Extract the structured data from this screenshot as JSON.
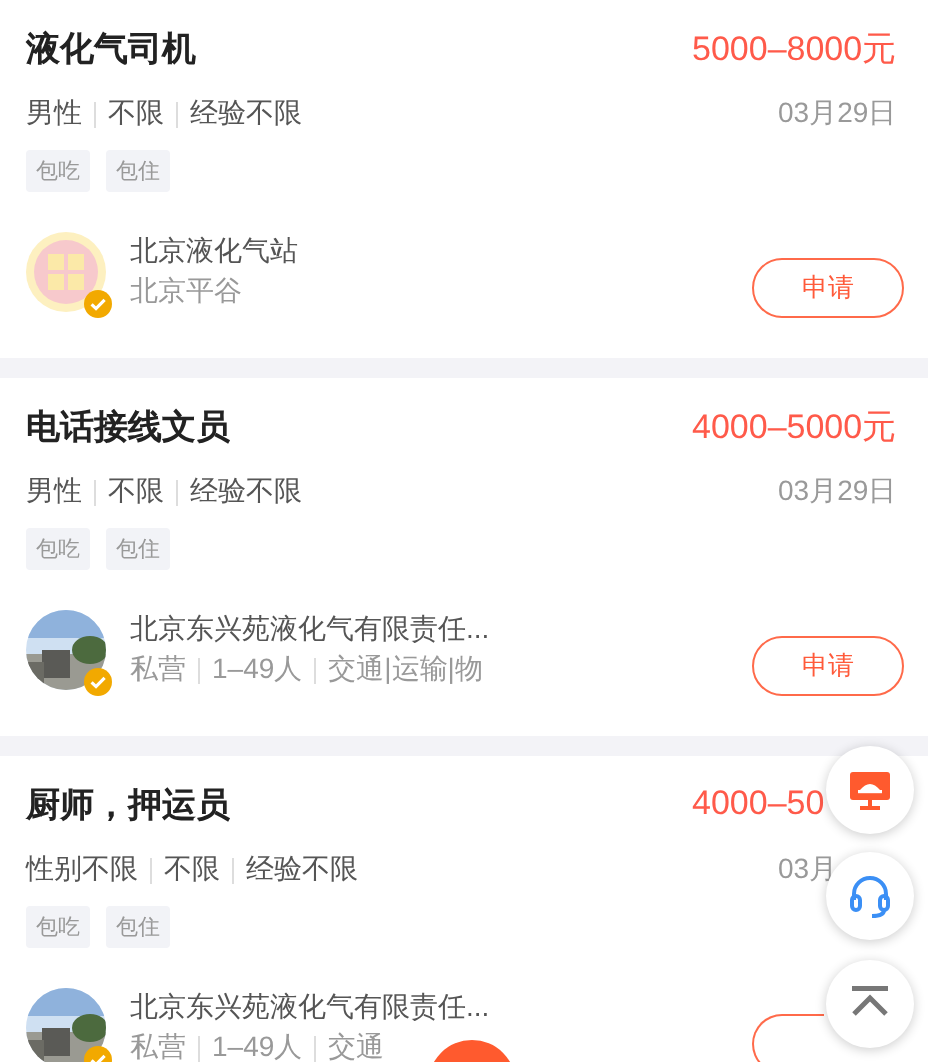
{
  "jobs": [
    {
      "title": "液化气司机",
      "salary": "5000–8000元",
      "meta": [
        "男性",
        "不限",
        "经验不限"
      ],
      "date": "03月29日",
      "tags": [
        "包吃",
        "包住"
      ],
      "company": {
        "name": "北京液化气站",
        "avatar": {
          "kind": "logo"
        },
        "details": [
          "北京平谷"
        ]
      },
      "apply": "申请"
    },
    {
      "title": "电话接线文员",
      "salary": "4000–5000元",
      "meta": [
        "男性",
        "不限",
        "经验不限"
      ],
      "date": "03月29日",
      "tags": [
        "包吃",
        "包住"
      ],
      "company": {
        "name": "北京东兴苑液化气有限责任...",
        "details": [
          "私营",
          "1–49人",
          "交通|运输|物"
        ]
      },
      "apply": "申请"
    },
    {
      "title": "厨师，押运员",
      "salary": "4000–50",
      "meta": [
        "性别不限",
        "不限",
        "经验不限"
      ],
      "date": "03月",
      "tags": [
        "包吃",
        "包住"
      ],
      "company": {
        "name": "北京东兴苑液化气有限责任...",
        "details": [
          "私营",
          "1–49人",
          "交通"
        ]
      }
    }
  ]
}
